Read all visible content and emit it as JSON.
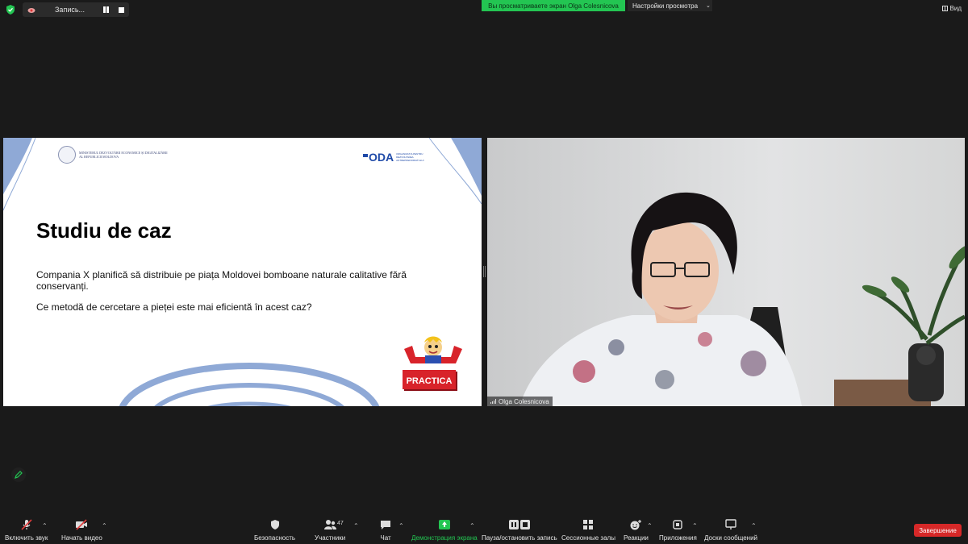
{
  "topbar": {
    "recording_label": "Запись...",
    "share_banner": "Вы просматриваете экран Olga Colesnicova",
    "view_options_label": "Настройки просмотра",
    "view_label": "Вид"
  },
  "slide": {
    "ministry_text": "MINISTERUL DEZVOLTĂRII ECONOMICE ȘI DIGITALIZĂRII AL REPUBLICII MOLDOVA",
    "oda_label": "ODA",
    "oda_subtitle": "ORGANIZAȚIA PENTRU DEZVOLTAREA ANTREPRENORIATULUI",
    "title": "Studiu de caz",
    "paragraph1": "Compania X planifică să distribuie pe piața Moldovei bomboane naturale calitative fără conservanți.",
    "paragraph2": "Ce metodă de cercetare a pieței este mai eficientă în acest caz?",
    "practica_label": "PRACTICA"
  },
  "video": {
    "participant_name": "Olga Colesnicova"
  },
  "toolbar": {
    "unmute_label": "Включить звук",
    "start_video_label": "Начать видео",
    "security_label": "Безопасность",
    "participants_label": "Участники",
    "participants_count": "47",
    "chat_label": "Чат",
    "share_screen_label": "Демонстрация экрана",
    "pause_record_label": "Пауза/остановить запись",
    "breakout_label": "Сессионные залы",
    "reactions_label": "Реакции",
    "apps_label": "Приложения",
    "whiteboard_label": "Доски сообщений",
    "end_label": "Завершение"
  },
  "colors": {
    "background": "#1a1a1a",
    "share_green": "#23c552",
    "end_red": "#d62828",
    "slide_accent": "#8fa9d6"
  }
}
